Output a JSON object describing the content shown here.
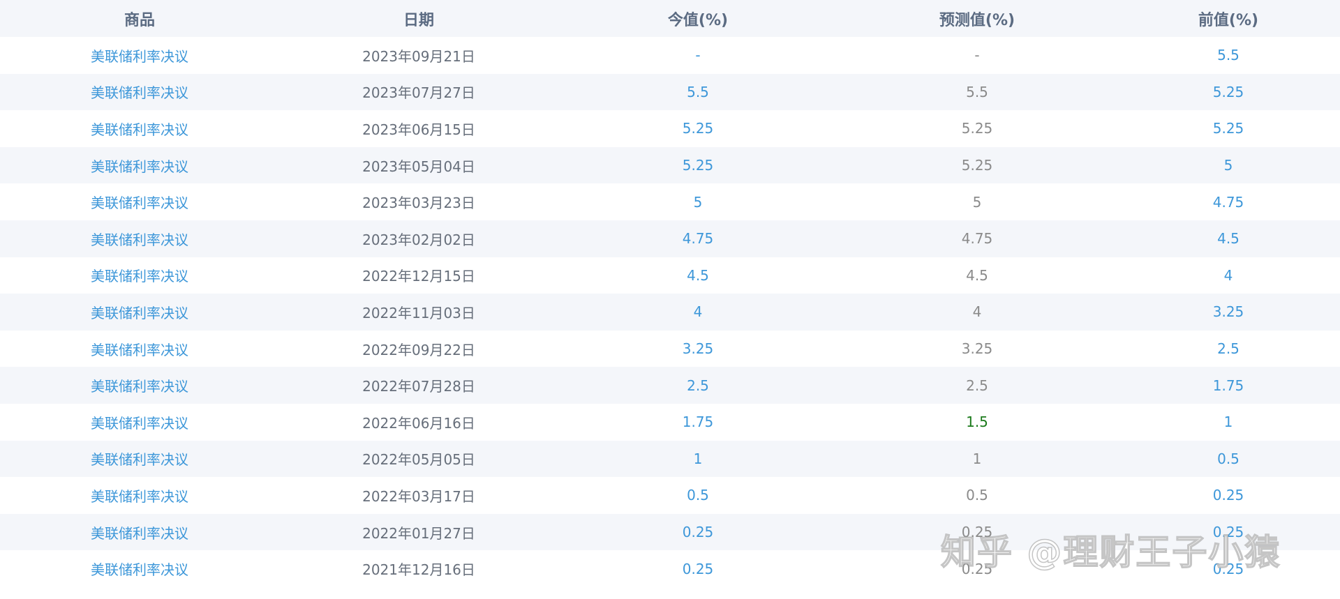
{
  "headers": {
    "name": "商品",
    "date": "日期",
    "now": "今值(%)",
    "forecast": "预测值(%)",
    "prev": "前值(%)"
  },
  "colors": {
    "link_blue": "#3d97d9",
    "date_gray": "#666e7a",
    "forecast_gray": "#8a8a8a",
    "forecast_green": "#1a7a1a",
    "header_bg": "#f4f6fa"
  },
  "rows": [
    {
      "name": "美联储利率决议",
      "date": "2023年09月21日",
      "now": "-",
      "forecast": "-",
      "prev": "5.5",
      "forecast_color": "gray"
    },
    {
      "name": "美联储利率决议",
      "date": "2023年07月27日",
      "now": "5.5",
      "forecast": "5.5",
      "prev": "5.25",
      "forecast_color": "gray"
    },
    {
      "name": "美联储利率决议",
      "date": "2023年06月15日",
      "now": "5.25",
      "forecast": "5.25",
      "prev": "5.25",
      "forecast_color": "gray"
    },
    {
      "name": "美联储利率决议",
      "date": "2023年05月04日",
      "now": "5.25",
      "forecast": "5.25",
      "prev": "5",
      "forecast_color": "gray"
    },
    {
      "name": "美联储利率决议",
      "date": "2023年03月23日",
      "now": "5",
      "forecast": "5",
      "prev": "4.75",
      "forecast_color": "gray"
    },
    {
      "name": "美联储利率决议",
      "date": "2023年02月02日",
      "now": "4.75",
      "forecast": "4.75",
      "prev": "4.5",
      "forecast_color": "gray"
    },
    {
      "name": "美联储利率决议",
      "date": "2022年12月15日",
      "now": "4.5",
      "forecast": "4.5",
      "prev": "4",
      "forecast_color": "gray"
    },
    {
      "name": "美联储利率决议",
      "date": "2022年11月03日",
      "now": "4",
      "forecast": "4",
      "prev": "3.25",
      "forecast_color": "gray"
    },
    {
      "name": "美联储利率决议",
      "date": "2022年09月22日",
      "now": "3.25",
      "forecast": "3.25",
      "prev": "2.5",
      "forecast_color": "gray"
    },
    {
      "name": "美联储利率决议",
      "date": "2022年07月28日",
      "now": "2.5",
      "forecast": "2.5",
      "prev": "1.75",
      "forecast_color": "gray"
    },
    {
      "name": "美联储利率决议",
      "date": "2022年06月16日",
      "now": "1.75",
      "forecast": "1.5",
      "prev": "1",
      "forecast_color": "green"
    },
    {
      "name": "美联储利率决议",
      "date": "2022年05月05日",
      "now": "1",
      "forecast": "1",
      "prev": "0.5",
      "forecast_color": "gray"
    },
    {
      "name": "美联储利率决议",
      "date": "2022年03月17日",
      "now": "0.5",
      "forecast": "0.5",
      "prev": "0.25",
      "forecast_color": "gray"
    },
    {
      "name": "美联储利率决议",
      "date": "2022年01月27日",
      "now": "0.25",
      "forecast": "0.25",
      "prev": "0.25",
      "forecast_color": "gray"
    },
    {
      "name": "美联储利率决议",
      "date": "2021年12月16日",
      "now": "0.25",
      "forecast": "0.25",
      "prev": "0.25",
      "forecast_color": "gray"
    }
  ],
  "watermark": "知乎 @理财王子小猿"
}
